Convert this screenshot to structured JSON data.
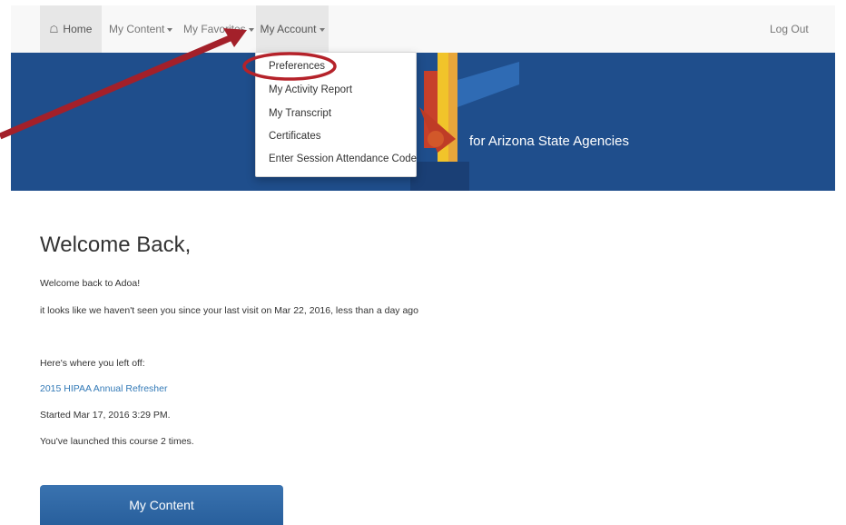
{
  "navbar": {
    "home": "Home",
    "my_content": "My Content",
    "my_favorites": "My Favorites",
    "my_account": "My Account",
    "logout": "Log Out"
  },
  "dropdown": {
    "items": [
      "Preferences",
      "My Activity Report",
      "My Transcript",
      "Certificates",
      "Enter Session Attendance Code"
    ]
  },
  "banner": {
    "tagline": "for Arizona State Agencies"
  },
  "main": {
    "title": "Welcome Back,",
    "greeting": "Welcome back to Adoa!",
    "last_visit": "it looks like we haven't seen you since your last visit on Mar 22, 2016, less than a day ago",
    "left_off": "Here's where you left off:",
    "course_name": "2015 HIPAA Annual Refresher",
    "started": "Started Mar 17, 2016 3:29 PM.",
    "launched": "You've launched this course 2 times.",
    "button": "My Content"
  },
  "colors": {
    "banner": "#1f4e8c",
    "link": "#337ab7",
    "annotation": "#b5222a"
  }
}
